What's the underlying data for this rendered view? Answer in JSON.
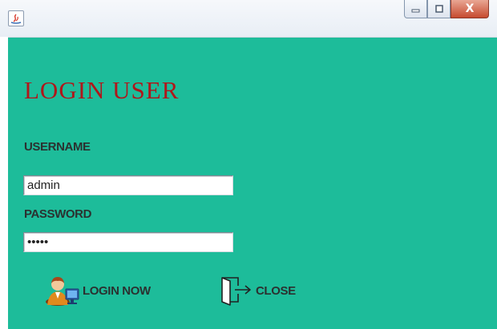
{
  "window": {
    "controls": {
      "minimize_icon": "minimize-icon",
      "maximize_icon": "maximize-icon",
      "close_label": "X"
    }
  },
  "form": {
    "heading": "LOGIN USER",
    "username_label": "USERNAME",
    "username_value": "admin",
    "password_label": "PASSWORD",
    "password_value": "•••••",
    "login_button_label": "LOGIN NOW",
    "login_icon": "user-computer-icon",
    "close_button_label": "CLOSE",
    "close_icon": "exit-door-icon"
  },
  "colors": {
    "panel_background": "#1dbc9a",
    "heading": "#b0161a",
    "label": "#2b3130"
  }
}
